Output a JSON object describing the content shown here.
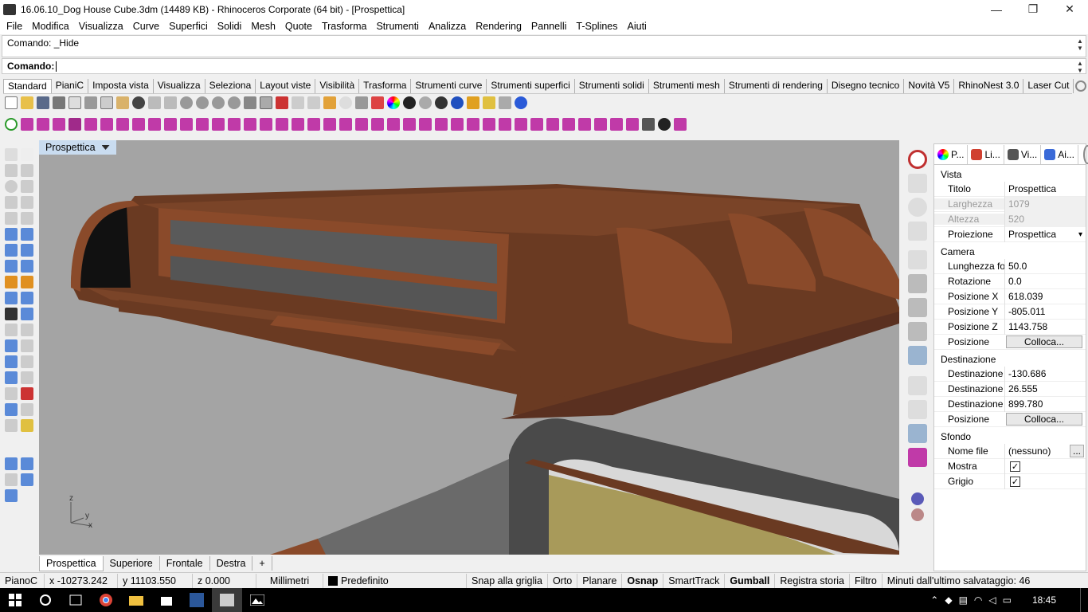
{
  "window": {
    "title": "16.06.10_Dog House Cube.3dm (14489 KB) - Rhinoceros Corporate (64 bit) - [Prospettica]",
    "minimize": "—",
    "restore": "❐",
    "close": "✕"
  },
  "menu": [
    "File",
    "Modifica",
    "Visualizza",
    "Curve",
    "Superfici",
    "Solidi",
    "Mesh",
    "Quote",
    "Trasforma",
    "Strumenti",
    "Analizza",
    "Rendering",
    "Pannelli",
    "T-Splines",
    "Aiuti"
  ],
  "command": {
    "history": "Comando: _Hide",
    "prompt": "Comando:"
  },
  "toolbar_tabs": [
    "Standard",
    "PianiC",
    "Imposta vista",
    "Visualizza",
    "Seleziona",
    "Layout viste",
    "Visibilità",
    "Trasforma",
    "Strumenti curve",
    "Strumenti superfici",
    "Strumenti solidi",
    "Strumenti mesh",
    "Strumenti di rendering",
    "Disegno tecnico",
    "Novità V5",
    "RhinoNest 3.0",
    "Laser Cut"
  ],
  "viewport": {
    "title": "Prospettica",
    "axes": {
      "z": "z",
      "y": "y",
      "x": "x"
    }
  },
  "view_tabs": [
    "Prospettica",
    "Superiore",
    "Frontale",
    "Destra"
  ],
  "add_view": "+",
  "panel": {
    "tabs": [
      "P...",
      "Li...",
      "Vi...",
      "Ai..."
    ],
    "sections": {
      "vista": "Vista",
      "camera": "Camera",
      "destinazione": "Destinazione",
      "sfondo": "Sfondo"
    },
    "vista_rows": [
      {
        "k": "Titolo",
        "v": "Prospettica"
      },
      {
        "k": "Larghezza",
        "v": "1079"
      },
      {
        "k": "Altezza",
        "v": "520"
      },
      {
        "k": "Proiezione",
        "v": "Prospettica"
      }
    ],
    "camera_rows": [
      {
        "k": "Lunghezza fo...",
        "v": "50.0"
      },
      {
        "k": "Rotazione",
        "v": "0.0"
      },
      {
        "k": "Posizione X",
        "v": "618.039"
      },
      {
        "k": "Posizione Y",
        "v": "-805.011"
      },
      {
        "k": "Posizione Z",
        "v": "1143.758"
      },
      {
        "k": "Posizione",
        "v": "Colloca..."
      }
    ],
    "dest_rows": [
      {
        "k": "Destinazione X",
        "v": "-130.686"
      },
      {
        "k": "Destinazione Y",
        "v": "26.555"
      },
      {
        "k": "Destinazione Z",
        "v": "899.780"
      },
      {
        "k": "Posizione",
        "v": "Colloca..."
      }
    ],
    "sfondo_rows": [
      {
        "k": "Nome file",
        "v": "(nessuno)",
        "extra": "..."
      },
      {
        "k": "Mostra",
        "v": "✓"
      },
      {
        "k": "Grigio",
        "v": "✓"
      }
    ]
  },
  "status": {
    "cplane": "PianoC",
    "x": "x -10273.242",
    "y": "y 11103.550",
    "z": "z 0.000",
    "units": "Millimetri",
    "layer": "Predefinito",
    "snap": "Snap alla griglia",
    "ortho": "Orto",
    "planar": "Planare",
    "osnap": "Osnap",
    "smarttrack": "SmartTrack",
    "gumball": "Gumball",
    "history": "Registra storia",
    "filter": "Filtro",
    "save": "Minuti dall'ultimo salvataggio: 46"
  },
  "taskbar": {
    "time": "18:45"
  },
  "colors": {
    "wood": "#8a4a2a",
    "viewport_bg": "#a4a4a4",
    "accent": "#c9dcf0"
  }
}
